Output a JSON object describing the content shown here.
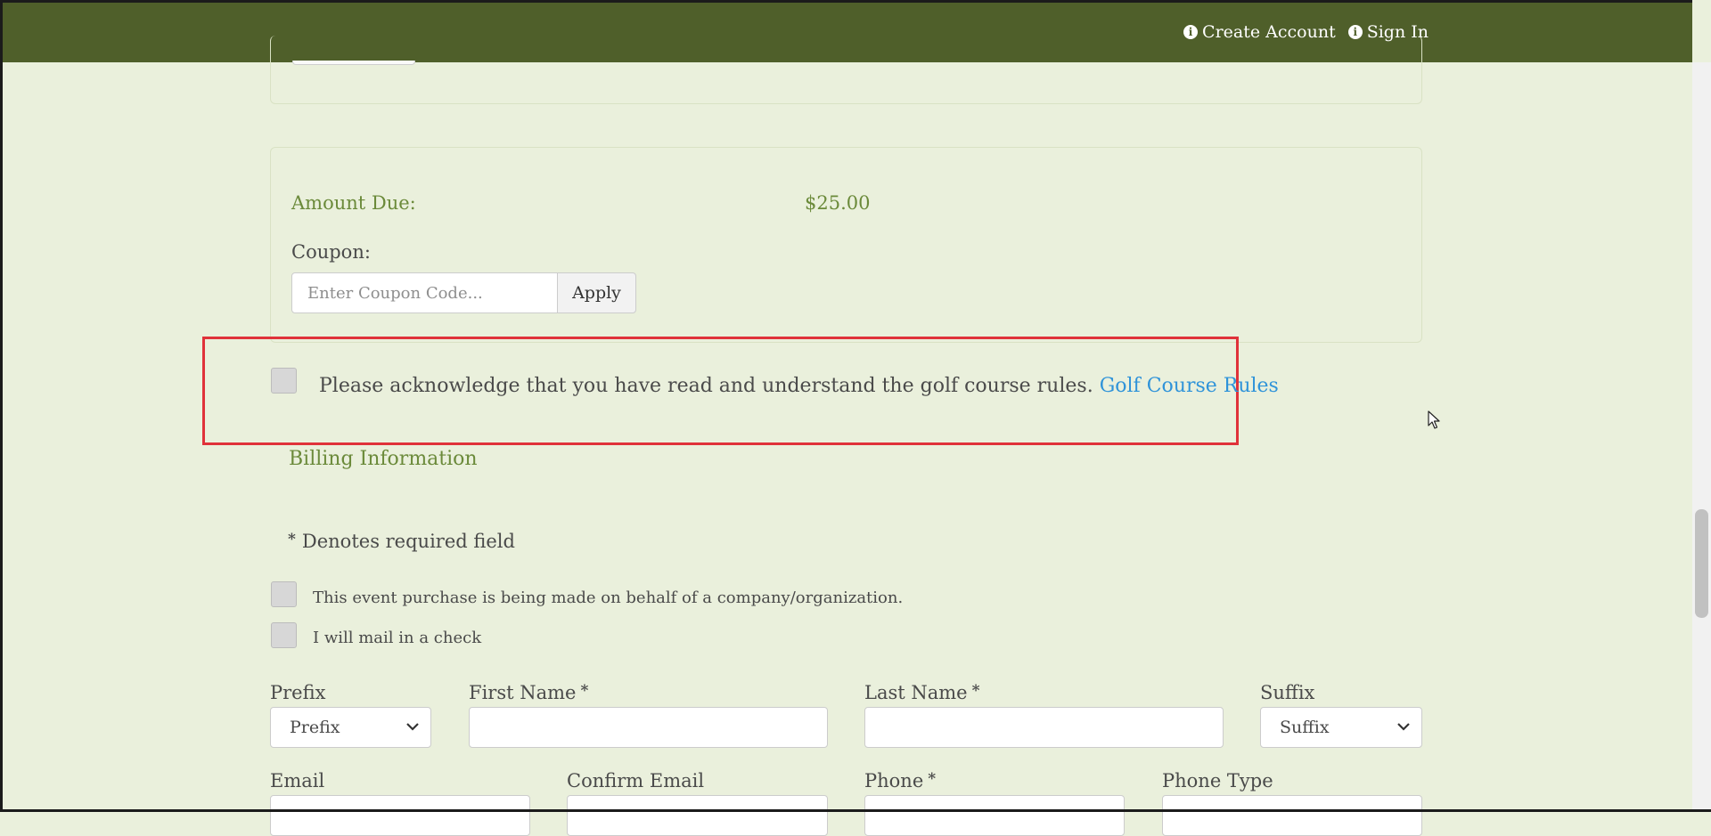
{
  "header": {
    "links": [
      {
        "label": "Create Account"
      },
      {
        "label": "Sign In"
      }
    ]
  },
  "payment": {
    "amount_label": "Amount Due:",
    "amount_value": "$25.00",
    "coupon_label": "Coupon:",
    "coupon_placeholder": "Enter Coupon Code...",
    "apply_label": "Apply"
  },
  "acknowledgement": {
    "text": "Please acknowledge that you have read and understand the golf course rules.",
    "link_label": "Golf Course Rules"
  },
  "billing": {
    "title": "Billing Information",
    "required_star": "*",
    "required_note": "Denotes required field",
    "options": [
      {
        "label": "This event purchase is being made on behalf of a company/organization."
      },
      {
        "label": "I will mail in a check"
      }
    ],
    "fields": {
      "prefix": {
        "label": "Prefix",
        "value": "Prefix"
      },
      "first_name": {
        "label": "First Name",
        "required": "*"
      },
      "last_name": {
        "label": "Last Name",
        "required": "*"
      },
      "suffix": {
        "label": "Suffix",
        "value": "Suffix"
      },
      "email": {
        "label": "Email"
      },
      "confirm_email": {
        "label": "Confirm Email"
      },
      "phone": {
        "label": "Phone",
        "required": "*"
      },
      "phone_type": {
        "label": "Phone Type"
      }
    }
  },
  "colors": {
    "header_bg": "#4f5f2a",
    "page_bg": "#eaf0dc",
    "accent_green": "#6b8a3a",
    "link_blue": "#2f93d9",
    "highlight_red": "#e0323a"
  },
  "icons": {
    "header_link_icon": "info-circle-icon",
    "select_chevron": "chevron-down-icon",
    "mouse_pointer": "mouse-cursor-icon"
  }
}
